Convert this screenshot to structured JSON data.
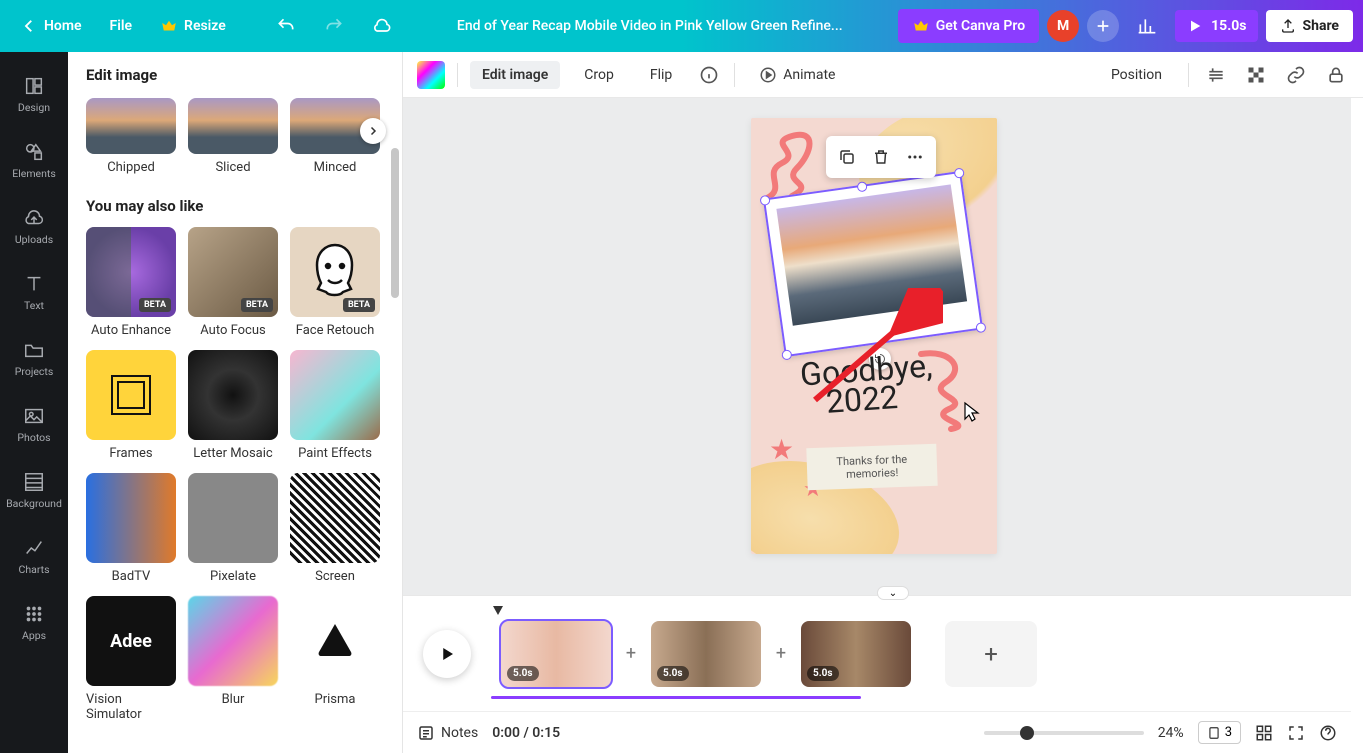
{
  "topbar": {
    "home": "Home",
    "file": "File",
    "resize": "Resize",
    "title": "End of Year Recap Mobile Video in Pink Yellow Green Refine...",
    "get_pro": "Get Canva Pro",
    "avatar_letter": "M",
    "duration": "15.0s",
    "share": "Share"
  },
  "rail": {
    "items": [
      {
        "label": "Design"
      },
      {
        "label": "Elements"
      },
      {
        "label": "Uploads"
      },
      {
        "label": "Text"
      },
      {
        "label": "Projects"
      },
      {
        "label": "Photos"
      },
      {
        "label": "Background"
      },
      {
        "label": "Charts"
      },
      {
        "label": "Apps"
      }
    ]
  },
  "panel": {
    "title": "Edit image",
    "top_row": [
      {
        "label": "Chipped"
      },
      {
        "label": "Sliced"
      },
      {
        "label": "Minced"
      }
    ],
    "section1": "You may also like",
    "effects": [
      {
        "label": "Auto Enhance",
        "badge": "BETA"
      },
      {
        "label": "Auto Focus",
        "badge": "BETA"
      },
      {
        "label": "Face Retouch",
        "badge": "BETA"
      },
      {
        "label": "Frames"
      },
      {
        "label": "Letter Mosaic"
      },
      {
        "label": "Paint Effects"
      },
      {
        "label": "BadTV"
      },
      {
        "label": "Pixelate"
      },
      {
        "label": "Screen"
      },
      {
        "label": "Vision Simulator"
      },
      {
        "label": "Blur"
      },
      {
        "label": "Prisma"
      }
    ]
  },
  "ctx": {
    "edit_image": "Edit image",
    "crop": "Crop",
    "flip": "Flip",
    "animate": "Animate",
    "position": "Position"
  },
  "canvas": {
    "script_line1": "Goodbye,",
    "script_line2": "2022",
    "tape_line1": "Thanks for the",
    "tape_line2": "memories!"
  },
  "timeline": {
    "clips": [
      {
        "dur": "5.0s"
      },
      {
        "dur": "5.0s"
      },
      {
        "dur": "5.0s"
      }
    ]
  },
  "bottom": {
    "notes": "Notes",
    "time": "0:00 / 0:15",
    "zoom": "24%",
    "page_count": "3"
  }
}
